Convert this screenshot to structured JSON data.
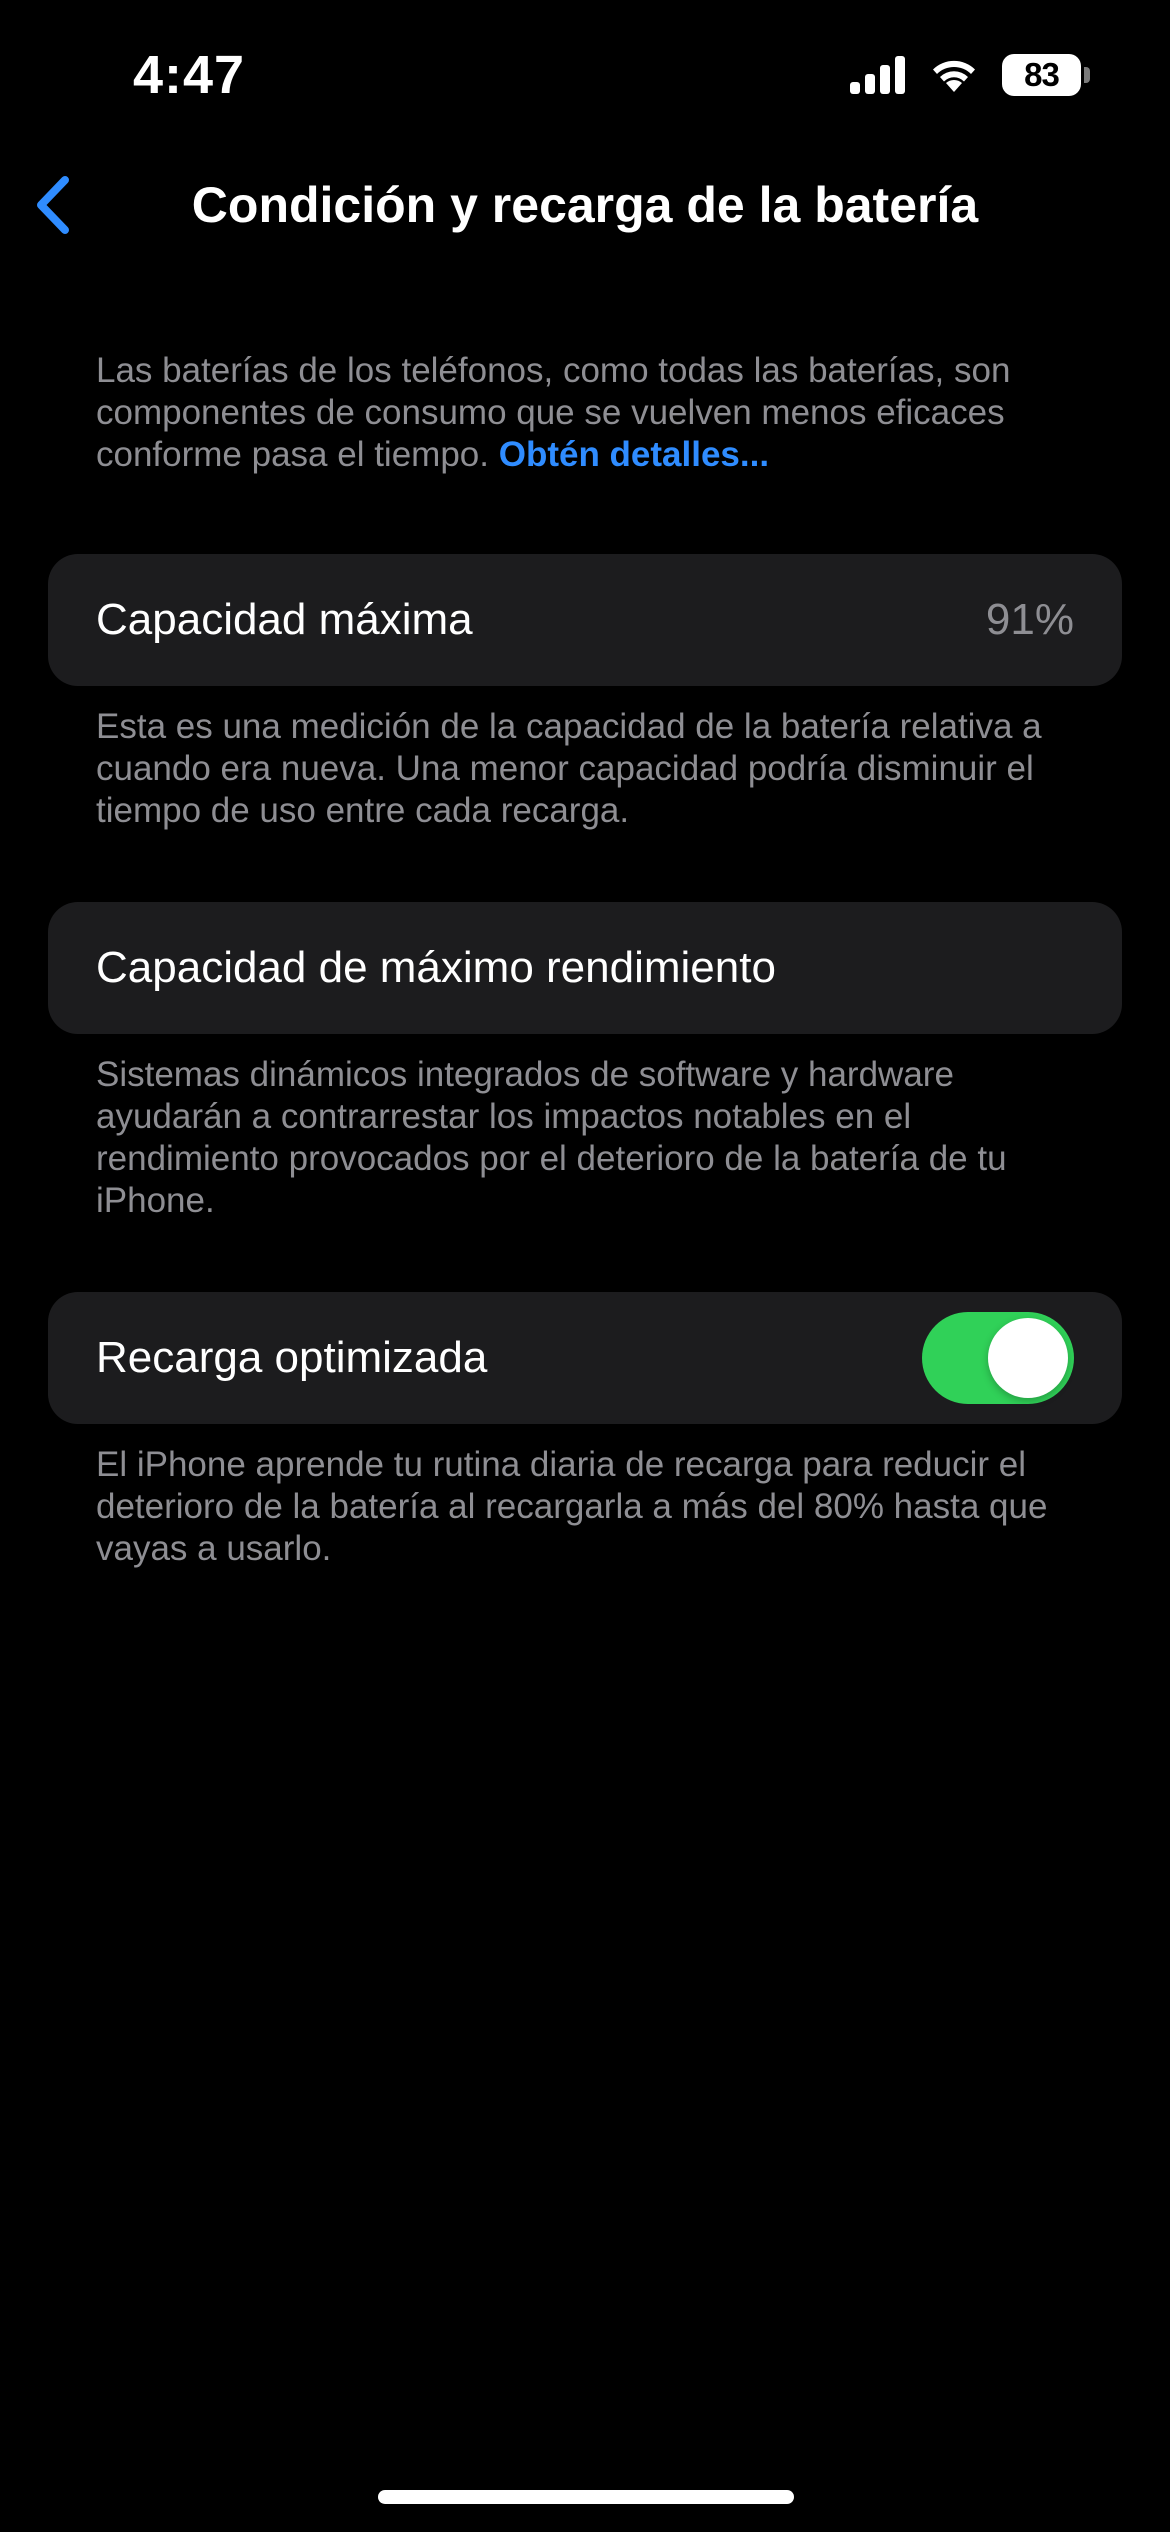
{
  "status_bar": {
    "time": "4:47",
    "battery_level": "83",
    "icons": [
      "cellular-signal-icon",
      "wifi-icon",
      "battery-icon"
    ]
  },
  "nav": {
    "back_icon": "chevron-left-icon",
    "title": "Condición y recarga de la batería"
  },
  "intro": {
    "text": "Las baterías de los teléfonos, como todas las baterías, son componentes de consumo que se vuelven menos eficaces conforme pasa el tiempo. ",
    "link": "Obtén detalles..."
  },
  "max_capacity": {
    "label": "Capacidad máxima",
    "value": "91%",
    "footnote": "Esta es una medición de la capacidad de la batería relativa a cuando era nueva. Una menor capacidad podría disminuir el tiempo de uso entre cada recarga."
  },
  "peak_performance": {
    "label": "Capacidad de máximo rendimiento",
    "footnote": "Sistemas dinámicos integrados de software y hardware ayudarán a contrarrestar los impactos notables en el rendimiento provocados por el deterioro de la batería de tu iPhone."
  },
  "optimized_charging": {
    "label": "Recarga optimizada",
    "enabled": true,
    "footnote": "El iPhone aprende tu rutina diaria de recarga para reducir el deterioro de la batería al recargarla a más del 80% hasta que vayas a usarlo."
  },
  "colors": {
    "background": "#000000",
    "card": "#1c1c1e",
    "accent": "#2f8cff",
    "toggle_on": "#30d158",
    "secondary_text": "#8e8e93"
  }
}
